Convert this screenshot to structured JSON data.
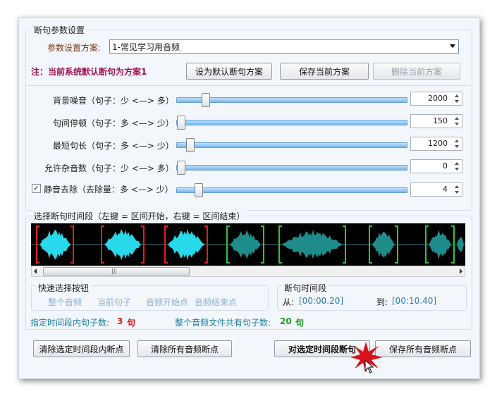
{
  "params_group": {
    "title": "断句参数设置",
    "scheme_label": "参数设置方案:",
    "scheme_value": "1-常见学习用音频",
    "note": "注：当前系统默认断句为方案1",
    "buttons": {
      "set_default": "设为默认断句方案",
      "save_current": "保存当前方案",
      "delete_current": "删除当前方案"
    },
    "sliders": [
      {
        "label": "背景噪音（句子：少 <—> 多）",
        "value": "2000",
        "level": 0.11
      },
      {
        "label": "句间停顿（句子：多 <—> 少）",
        "value": "150",
        "level": 0.0
      },
      {
        "label": "最短句长（句子：多 <—> 少）",
        "value": "1200",
        "level": 0.04
      },
      {
        "label": "允许杂音数（句子：少 <—> 多）",
        "value": "0",
        "level": 0.0
      },
      {
        "label": "静音去除（去除量：多 <—> 少）",
        "value": "4",
        "level": 0.08,
        "checked": true
      }
    ]
  },
  "segment_group": {
    "title": "选择断句时间段（左键 = 区间开始，右键 = 区间结束）",
    "quick_select": {
      "title": "快速选择按钮",
      "items": [
        "整个音频",
        "当前句子",
        "音频开始点",
        "音频结束点"
      ]
    },
    "time_range": {
      "title": "断句时间段",
      "from_label": "从:",
      "from_value": "[00:00.20]",
      "to_label": "到:",
      "to_value": "[00:10.40]"
    },
    "stats": {
      "in_range_label": "指定时间段内句子数:",
      "in_range_value": "3",
      "in_range_unit": "句",
      "total_label": "整个音频文件共有句子数:",
      "total_value": "20",
      "total_unit": "句"
    }
  },
  "footer": {
    "clear_range": "清除选定时间段内断点",
    "clear_all": "清除所有音频断点",
    "split_range": "对选定时间段断句",
    "save_all": "保存所有音频断点"
  },
  "colors": {
    "note": "#a3124f",
    "wave_active": "#27d9ea",
    "wave_inactive": "#1e8c8a",
    "marker_red": "#e22020",
    "marker_green": "#33c23a",
    "time_value": "#2a78b8",
    "stats_label": "#1c7fa7",
    "stats_red": "#e01818",
    "stats_green": "#1d9b22"
  },
  "icons": {
    "scrollbar_grip": "|||",
    "checkmark": "✓"
  }
}
